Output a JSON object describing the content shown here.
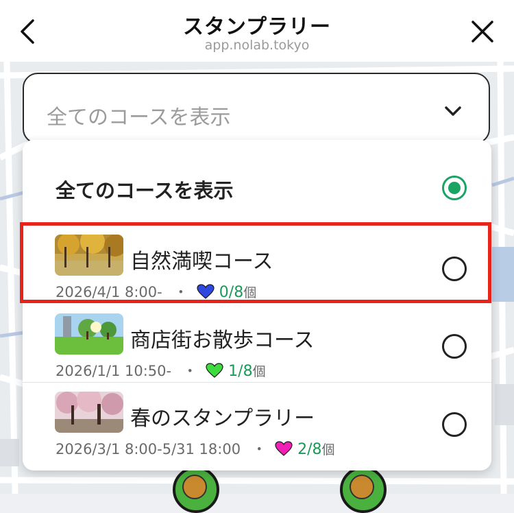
{
  "header": {
    "title": "スタンプラリー",
    "url": "app.nolab.tokyo",
    "back_icon": "chevron-left-icon",
    "close_icon": "close-icon"
  },
  "select": {
    "current_value": "全てのコースを表示",
    "chevron_icon": "chevron-down-icon"
  },
  "dropdown": {
    "all_option": {
      "label": "全てのコースを表示",
      "selected": true
    },
    "courses": [
      {
        "name": "自然満喫コース",
        "period": "2026/4/1 8:00-",
        "separator": "・",
        "heart_color": "#2f48e0",
        "progress": "0/8",
        "unit": "個",
        "selected": false,
        "highlighted": true
      },
      {
        "name": "商店街お散歩コース",
        "period": "2026/1/1 10:50-",
        "separator": "・",
        "heart_color": "#3ddb3d",
        "progress": "1/8",
        "unit": "個",
        "selected": false,
        "highlighted": false
      },
      {
        "name": "春のスタンプラリー",
        "period": "2026/3/1 8:00-5/31 18:00",
        "separator": "・",
        "heart_color": "#f21fb6",
        "progress": "2/8",
        "unit": "個",
        "selected": false,
        "highlighted": false
      }
    ]
  },
  "colors": {
    "selected_radio": "#19a463",
    "progress_text": "#1a9a59",
    "highlight_border": "#e8231a"
  }
}
